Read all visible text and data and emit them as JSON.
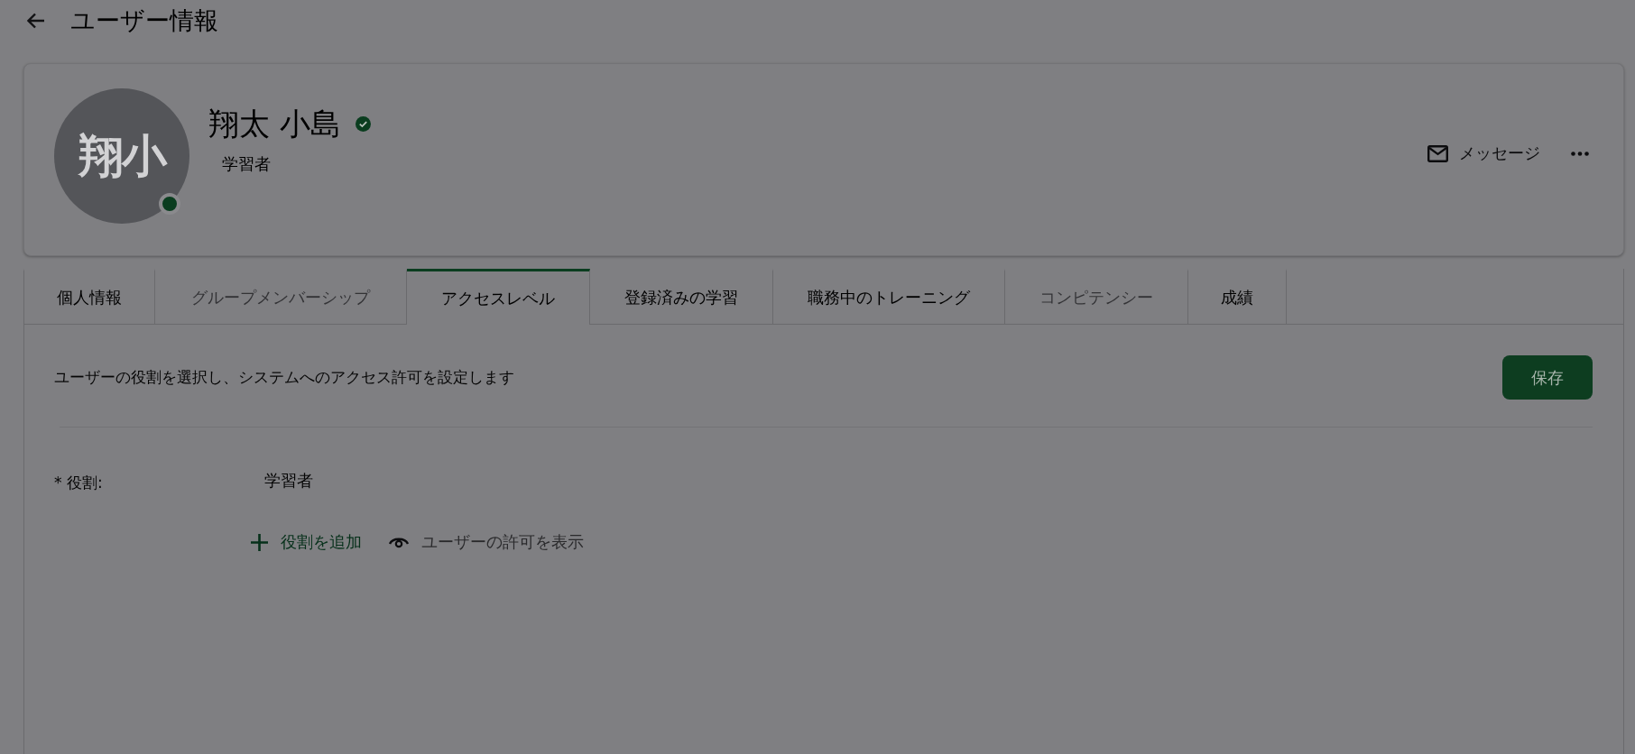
{
  "header": {
    "title": "ユーザー情報"
  },
  "profile": {
    "initials": "翔小",
    "online": true,
    "name": "翔太 小島",
    "verified": true,
    "role": "学習者",
    "message": "メッセージ"
  },
  "tabs": [
    {
      "label": "個人情報",
      "selected": false,
      "disabled": false
    },
    {
      "label": "グループメンバーシップ",
      "selected": false,
      "disabled": true
    },
    {
      "label": "アクセスレベル",
      "selected": true,
      "disabled": false
    },
    {
      "label": "登録済みの学習",
      "selected": false,
      "disabled": false
    },
    {
      "label": "職務中のトレーニング",
      "selected": false,
      "disabled": false
    },
    {
      "label": "コンピテンシー",
      "selected": false,
      "disabled": true
    },
    {
      "label": "成績",
      "selected": false,
      "disabled": false
    }
  ],
  "access": {
    "description": "ユーザーの役割を選択し、システムへのアクセス許可を設定します",
    "save": "保存",
    "role_label": "* 役割:",
    "role_value": "学習者",
    "add_role": "役割を追加",
    "view_permissions": "ユーザーの許可を表示"
  }
}
